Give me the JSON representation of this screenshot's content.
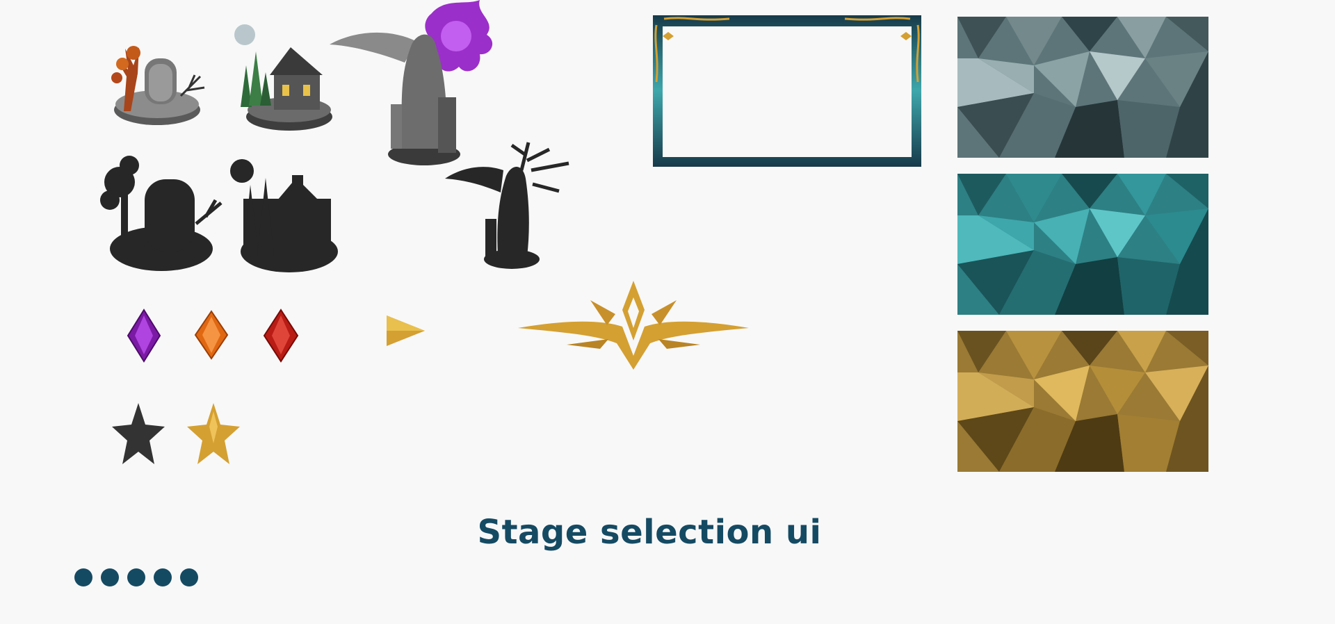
{
  "title": "Stage selection ui",
  "pagination": {
    "count": 5
  },
  "palette": {
    "accent": "#154a63",
    "gold": "#d4a032",
    "teal": "#3ea7ab",
    "slate": "#6f8a8e",
    "silhouette": "#272727"
  },
  "assets": {
    "stage_thumbnails": [
      "graveyard-icon",
      "cottage-icon",
      "angel-statue-icon"
    ],
    "stage_silhouettes": [
      "graveyard-silhouette-icon",
      "cottage-silhouette-icon",
      "angel-statue-silhouette-icon"
    ],
    "gems": [
      "purple-gem-icon",
      "orange-gem-icon",
      "red-gem-icon"
    ],
    "arrow": "play-arrow-icon",
    "emblem": "gold-crest-icon",
    "stars": [
      "star-empty-icon",
      "star-filled-icon"
    ],
    "frame": "ornate-frame-icon",
    "backgrounds": [
      "slate-polygon-pattern",
      "teal-polygon-pattern",
      "gold-polygon-pattern"
    ]
  }
}
